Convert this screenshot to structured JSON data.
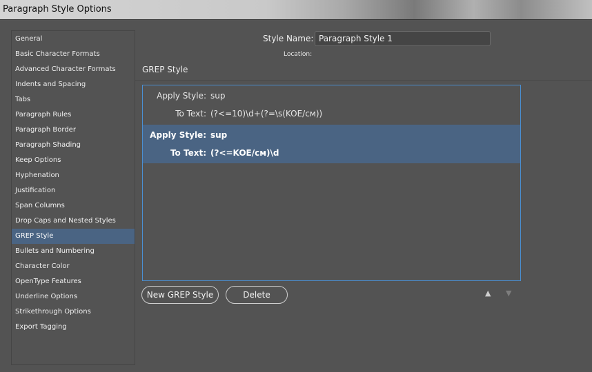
{
  "window": {
    "title": "Paragraph Style Options"
  },
  "sidebar": {
    "items": [
      "General",
      "Basic Character Formats",
      "Advanced Character Formats",
      "Indents and Spacing",
      "Tabs",
      "Paragraph Rules",
      "Paragraph Border",
      "Paragraph Shading",
      "Keep Options",
      "Hyphenation",
      "Justification",
      "Span Columns",
      "Drop Caps and Nested Styles",
      "GREP Style",
      "Bullets and Numbering",
      "Character Color",
      "OpenType Features",
      "Underline Options",
      "Strikethrough Options",
      "Export Tagging"
    ],
    "selected": "GREP Style"
  },
  "header": {
    "style_name_label": "Style Name:",
    "style_name_value": "Paragraph Style 1",
    "location_label": "Location:"
  },
  "section": {
    "title": "GREP Style"
  },
  "grep_rules": [
    {
      "apply_label": "Apply Style:",
      "style": "sup",
      "text_label": "To Text:",
      "expression": "(?<=10)\\d+(?=\\s(KOE/см))",
      "selected": false
    },
    {
      "apply_label": "Apply Style:",
      "style": "sup",
      "text_label": "To Text:",
      "expression": "(?<=KOE/см)\\d",
      "selected": true
    }
  ],
  "buttons": {
    "new_label": "New GREP Style",
    "delete_label": "Delete"
  },
  "arrows": {
    "up": "▲",
    "down": "▼"
  },
  "colors": {
    "selection": "#4a6483",
    "focus_border": "#4a8fd2",
    "background": "#535353"
  }
}
